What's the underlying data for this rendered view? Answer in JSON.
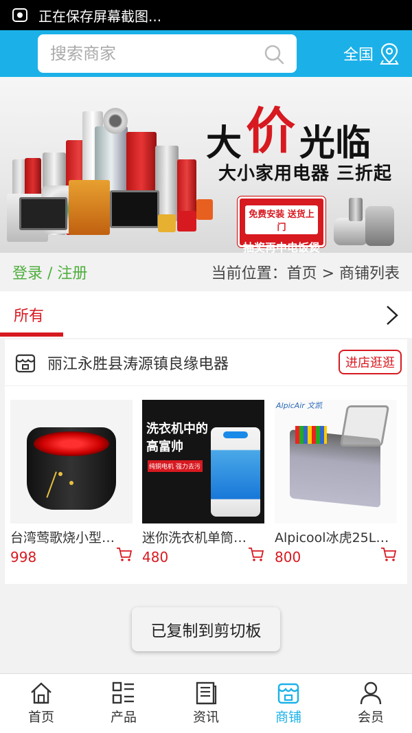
{
  "status_bar": {
    "text": "正在保存屏幕截图..."
  },
  "search": {
    "placeholder": "搜索商家"
  },
  "region": {
    "label": "全国"
  },
  "banner": {
    "title_1": "大",
    "title_2": "价",
    "title_3": "光临",
    "subtitle": "大小家用电器 三折起",
    "badge_line1": "免费安装 送货上门",
    "badge_line2": "抽奖再中电饭煲"
  },
  "location": {
    "login": "登录 / 注册",
    "breadcrumb": "当前位置：首页 > 商铺列表"
  },
  "tabs": {
    "all": "所有"
  },
  "shop": {
    "name": "丽江永胜县涛源镇良缘电器",
    "enter_label": "进店逛逛",
    "products": [
      {
        "name": "台湾莺歌烧小型…",
        "price": "998",
        "image_text": ""
      },
      {
        "name": "迷你洗衣机单筒…",
        "price": "480",
        "image_text": "洗衣机中的 高富帅",
        "image_sub": "纯铜电机 强力去污"
      },
      {
        "name": "Alpicool冰虎25L…",
        "price": "800",
        "image_text": "AlpicAir 文凯"
      }
    ]
  },
  "toast": {
    "text": "已复制到剪切板"
  },
  "bottom_nav": [
    {
      "label": "首页",
      "icon": "home-icon"
    },
    {
      "label": "产品",
      "icon": "grid-list-icon"
    },
    {
      "label": "资讯",
      "icon": "news-icon"
    },
    {
      "label": "商铺",
      "icon": "shop-icon",
      "active": true
    },
    {
      "label": "会员",
      "icon": "user-icon"
    }
  ],
  "colors": {
    "primary": "#1bb1e8",
    "accent": "#d71920",
    "login_green": "#4fae3e"
  }
}
